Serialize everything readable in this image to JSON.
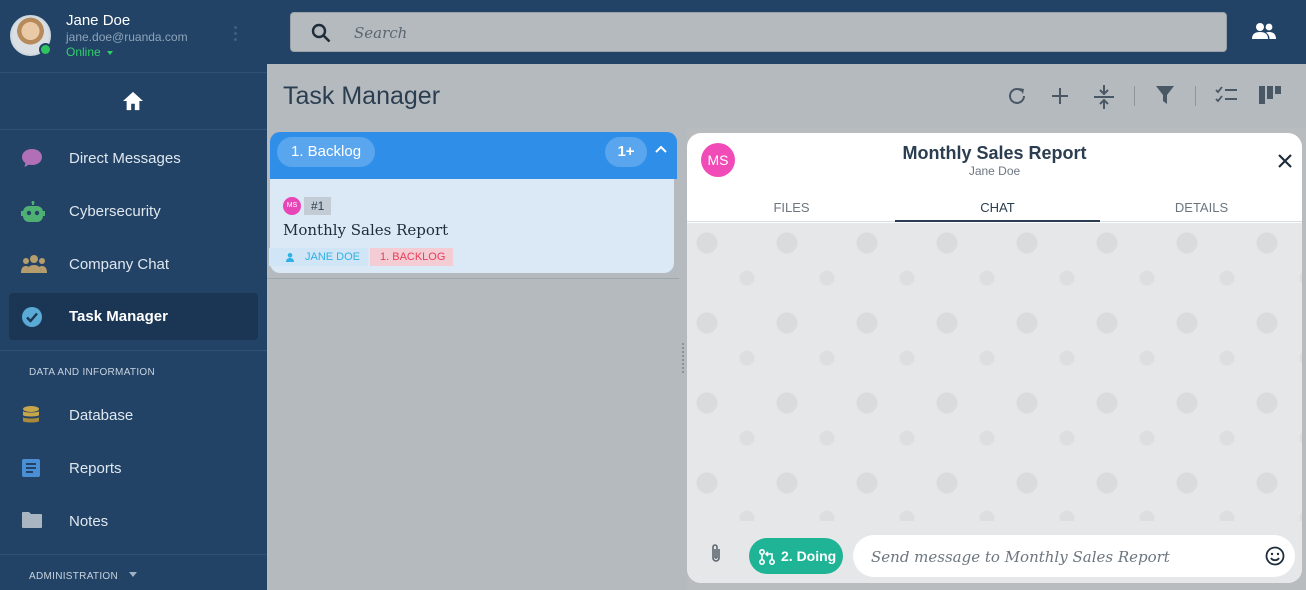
{
  "user": {
    "name": "Jane Doe",
    "email": "jane.doe@ruanda.com",
    "status": "Online",
    "status_color": "#2fd06a"
  },
  "sidebar": {
    "items": [
      {
        "label": "Direct Messages",
        "icon": "chat-bubble-icon",
        "color": "#b06fb6"
      },
      {
        "label": "Cybersecurity",
        "icon": "robot-icon",
        "color": "#4fb073"
      },
      {
        "label": "Company Chat",
        "icon": "group-icon",
        "color": "#b59d6d"
      },
      {
        "label": "Task Manager",
        "icon": "check-circle-icon",
        "color": "#5aaad6",
        "active": true
      }
    ],
    "section_data": "DATA AND INFORMATION",
    "data_items": [
      {
        "label": "Database",
        "icon": "database-icon",
        "color": "#c8a64a"
      },
      {
        "label": "Reports",
        "icon": "report-icon",
        "color": "#4a8fd6"
      },
      {
        "label": "Notes",
        "icon": "folder-icon",
        "color": "#a9b6c2"
      }
    ],
    "section_admin": "ADMINISTRATION"
  },
  "search": {
    "placeholder": "Search"
  },
  "header": {
    "title": "Task Manager"
  },
  "board": {
    "column": {
      "label": "1. Backlog",
      "count": "1+"
    },
    "card": {
      "avatar": "MS",
      "number": "#1",
      "title": "Monthly Sales Report",
      "assignee": "JANE DOE",
      "status": "1. BACKLOG"
    }
  },
  "panel": {
    "avatar": "MS",
    "title": "Monthly Sales Report",
    "subtitle": "Jane Doe",
    "tabs": [
      "FILES",
      "CHAT",
      "DETAILS"
    ],
    "active_tab": "CHAT",
    "stage_button": "2. Doing",
    "message_placeholder": "Send message to Monthly Sales Report"
  },
  "colors": {
    "sidebar_bg": "#224366",
    "accent_blue": "#2f8fe8",
    "doing_green": "#1fb496",
    "avatar_pink": "#f04bb7"
  }
}
